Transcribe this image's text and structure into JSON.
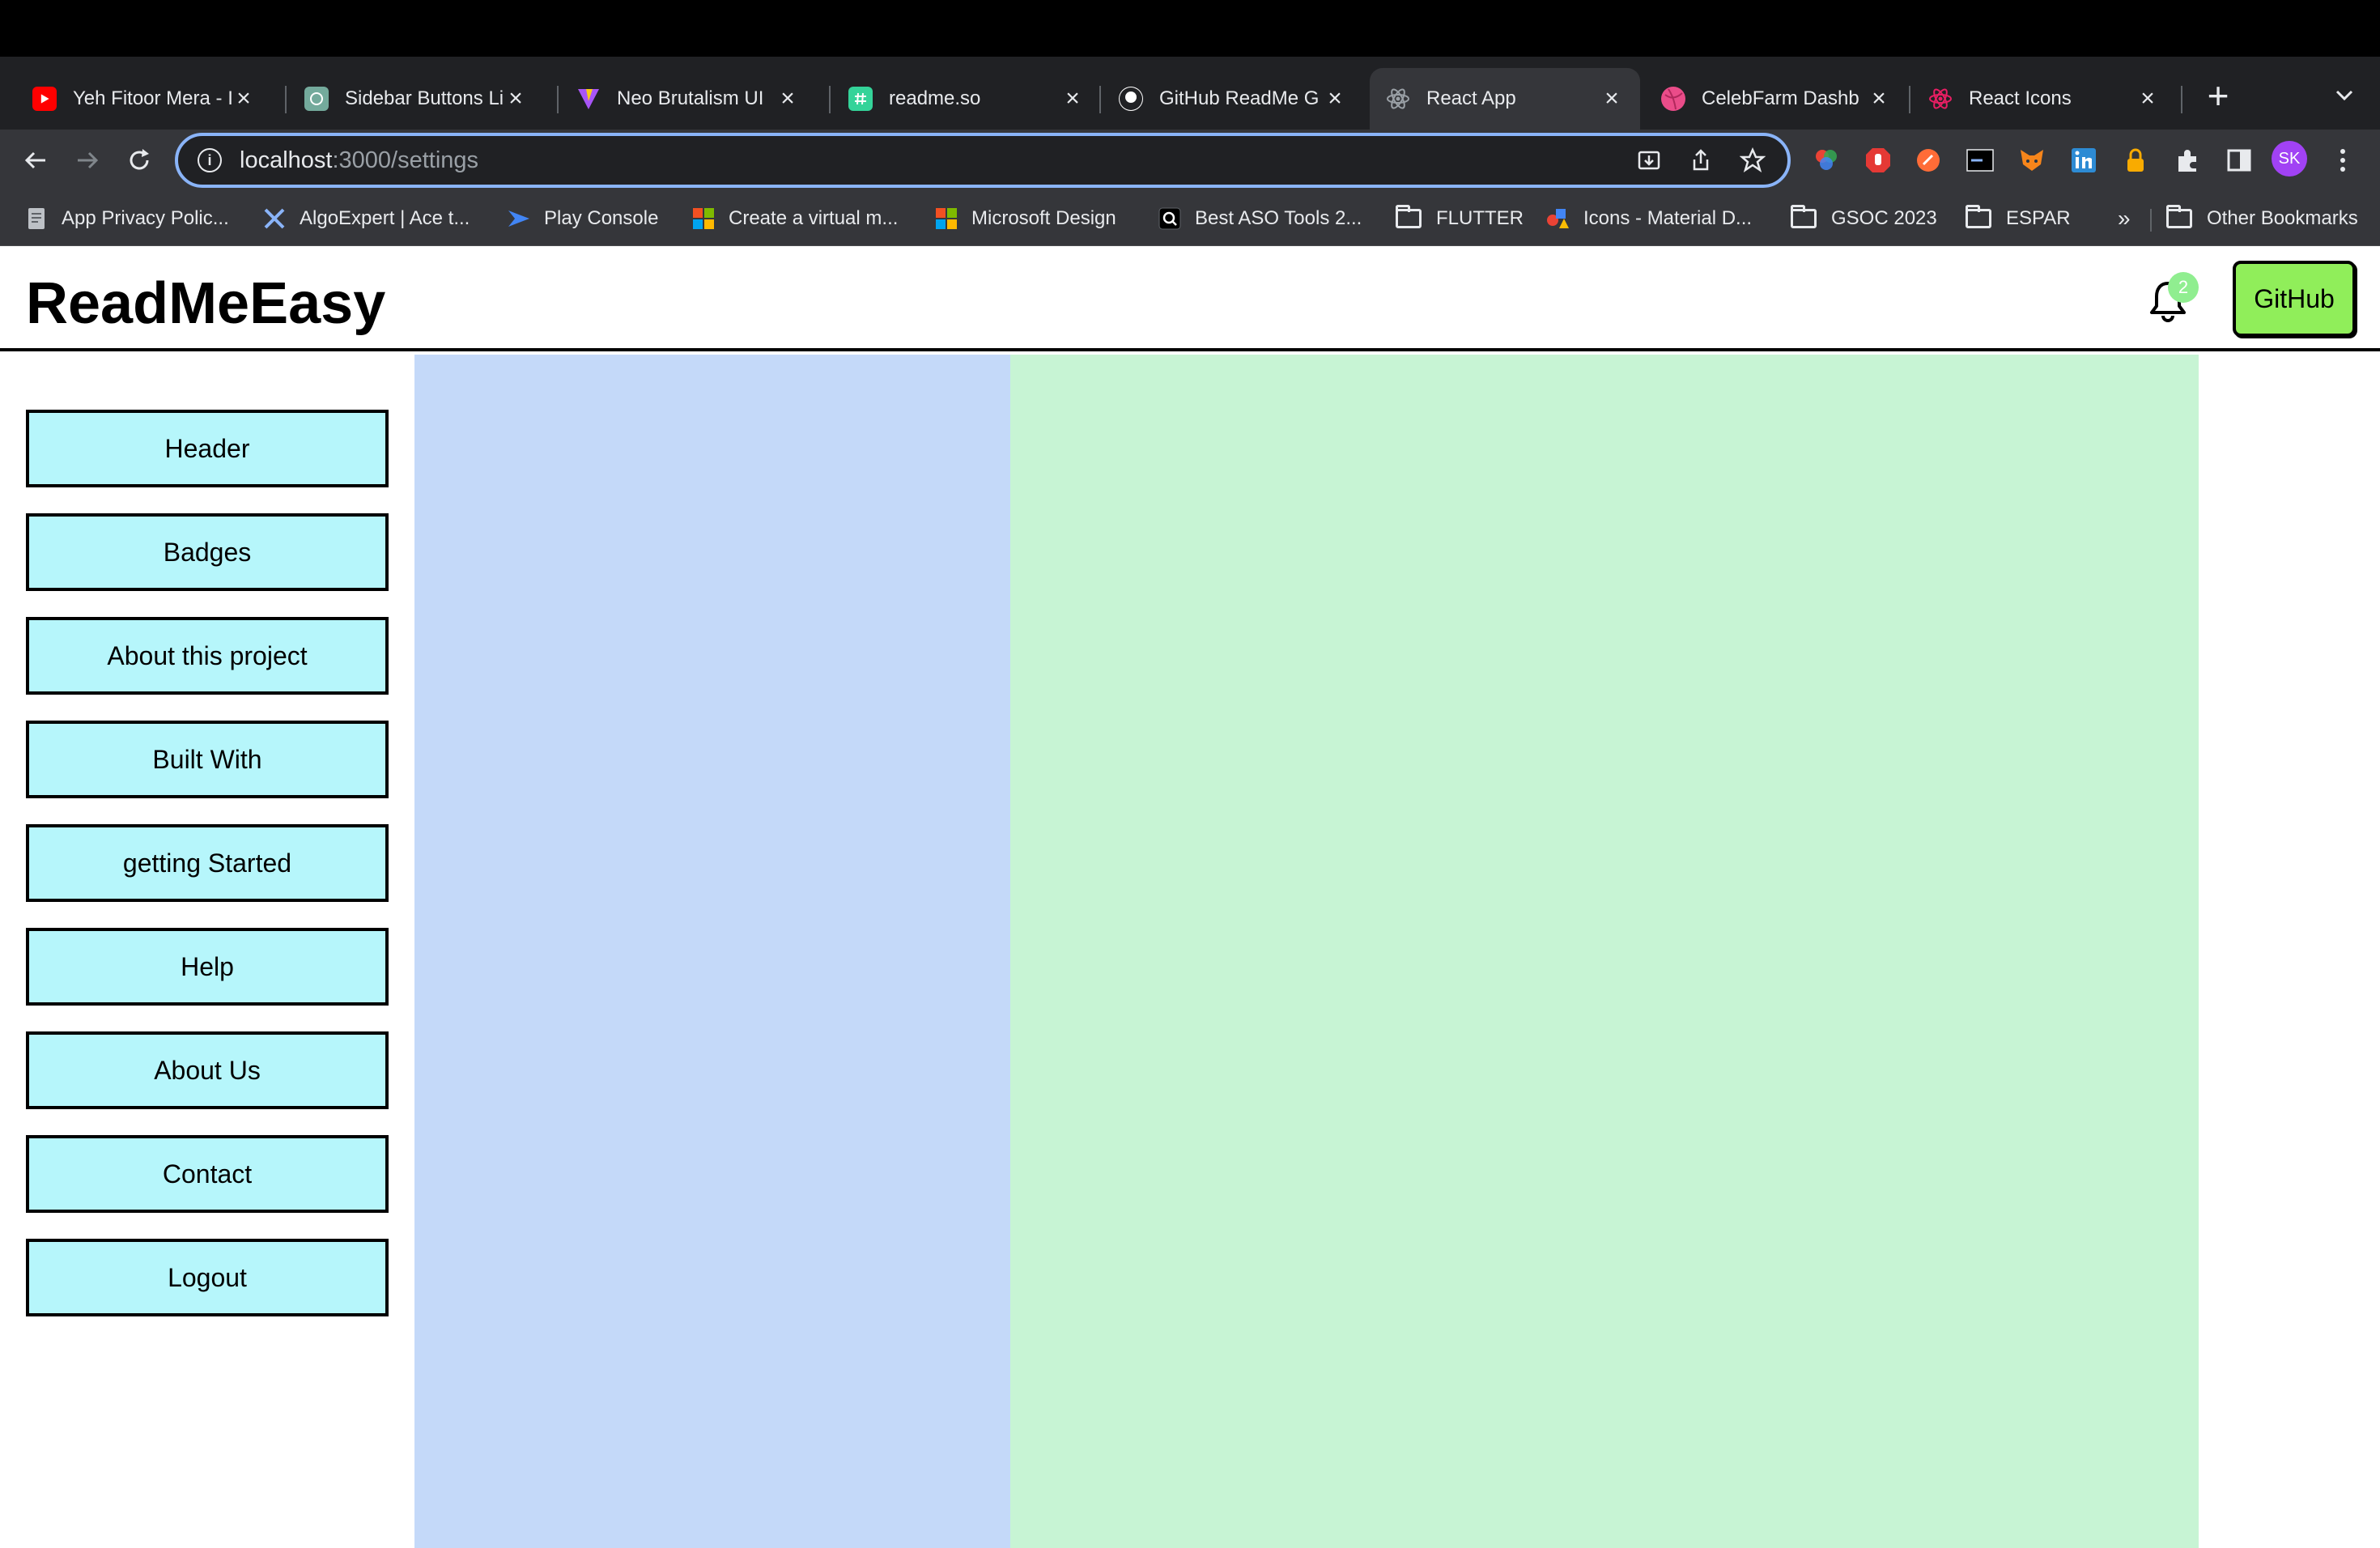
{
  "browser": {
    "tabs": [
      {
        "title": "Yeh Fitoor Mera - I",
        "icon": "youtube-icon",
        "color": "#ff0000"
      },
      {
        "title": "Sidebar Buttons Li",
        "icon": "chatgpt-icon",
        "color": "#74aa9c"
      },
      {
        "title": "Neo Brutalism UI",
        "icon": "vite-icon",
        "color": "#a855f7"
      },
      {
        "title": "readme.so",
        "icon": "readme-icon",
        "color": "#34d399"
      },
      {
        "title": "GitHub ReadMe G",
        "icon": "github-icon",
        "color": "#ffffff"
      },
      {
        "title": "React App",
        "icon": "react-icon",
        "color": "#61dafb"
      },
      {
        "title": "CelebFarm Dashb",
        "icon": "dribbble-icon",
        "color": "#ea4c89"
      },
      {
        "title": "React Icons",
        "icon": "react-icon",
        "color": "#e91e63"
      }
    ],
    "url_host": "localhost",
    "url_path": ":3000/settings",
    "avatar_initials": "SK",
    "bookmarks": [
      {
        "label": "App Privacy Polic...",
        "icon": "document-icon"
      },
      {
        "label": "AlgoExpert | Ace t...",
        "icon": "algoexpert-icon"
      },
      {
        "label": "Play Console",
        "icon": "play-console-icon"
      },
      {
        "label": "Create a virtual m...",
        "icon": "microsoft-icon"
      },
      {
        "label": "Microsoft Design",
        "icon": "microsoft-icon"
      },
      {
        "label": "Best ASO Tools 2...",
        "icon": "aso-icon"
      },
      {
        "label": "FLUTTER",
        "icon": "folder-icon"
      },
      {
        "label": "Icons - Material D...",
        "icon": "material-icon"
      },
      {
        "label": "GSOC 2023",
        "icon": "folder-icon"
      },
      {
        "label": "ESPAR",
        "icon": "folder-icon"
      }
    ],
    "bookmarks_overflow": "»",
    "other_bookmarks": "Other Bookmarks"
  },
  "app": {
    "brand": "ReadMeEasy",
    "notification_count": "2",
    "github_label": "GitHub",
    "sidebar": [
      "Header",
      "Badges",
      "About this project",
      "Built With",
      "getting Started",
      "Help",
      "About Us",
      "Contact",
      "Logout"
    ],
    "colors": {
      "sidebar_button": "#b6f6fb",
      "panel_left": "#c4d9f9",
      "panel_right": "#c7f4d4",
      "github_button": "#90ee5a",
      "badge": "#90ee90"
    }
  }
}
